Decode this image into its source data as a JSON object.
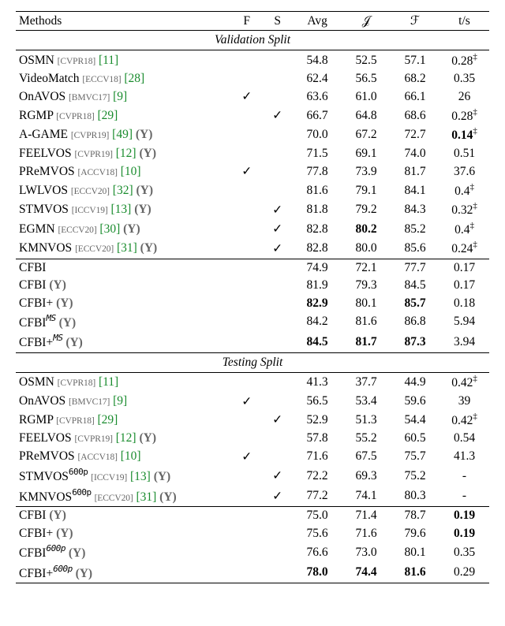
{
  "chart_data": {
    "type": "table",
    "title": "",
    "columns": [
      "Methods",
      "F",
      "S",
      "Avg",
      "J",
      "F",
      "t/s"
    ],
    "sections": [
      {
        "name": "Validation Split",
        "rows": [
          [
            "OSMN [CVPR18] [11]",
            "",
            "",
            54.8,
            52.5,
            57.1,
            "0.28‡"
          ],
          [
            "VideoMatch [ECCV18] [28]",
            "",
            "",
            62.4,
            56.5,
            68.2,
            "0.35"
          ],
          [
            "OnAVOS [BMVC17] [9]",
            "✓",
            "",
            63.6,
            61.0,
            66.1,
            "26"
          ],
          [
            "RGMP [CVPR18] [29]",
            "",
            "✓",
            66.7,
            64.8,
            68.6,
            "0.28‡"
          ],
          [
            "A-GAME [CVPR19] [49] (Y)",
            "",
            "",
            70.0,
            67.2,
            72.7,
            "0.14‡"
          ],
          [
            "FEELVOS [CVPR19] [12] (Y)",
            "",
            "",
            71.5,
            69.1,
            74.0,
            "0.51"
          ],
          [
            "PReMVOS [ACCV18] [10]",
            "✓",
            "",
            77.8,
            73.9,
            81.7,
            "37.6"
          ],
          [
            "LWLVOS [ECCV20] [32] (Y)",
            "",
            "",
            81.6,
            79.1,
            84.1,
            "0.4‡"
          ],
          [
            "STMVOS [ICCV19] [13] (Y)",
            "",
            "✓",
            81.8,
            79.2,
            84.3,
            "0.32‡"
          ],
          [
            "EGMN [ECCV20] [30] (Y)",
            "",
            "✓",
            82.8,
            80.2,
            85.2,
            "0.4‡"
          ],
          [
            "KMNVOS [ECCV20] [31] (Y)",
            "",
            "✓",
            82.8,
            80.0,
            85.6,
            "0.24‡"
          ],
          [
            "CFBI",
            "",
            "",
            74.9,
            72.1,
            77.7,
            "0.17"
          ],
          [
            "CFBI (Y)",
            "",
            "",
            81.9,
            79.3,
            84.5,
            "0.17"
          ],
          [
            "CFBI+ (Y)",
            "",
            "",
            82.9,
            80.1,
            85.7,
            "0.18"
          ],
          [
            "CFBI^MS (Y)",
            "",
            "",
            84.2,
            81.6,
            86.8,
            "5.94"
          ],
          [
            "CFBI+^MS (Y)",
            "",
            "",
            84.5,
            81.7,
            87.3,
            "3.94"
          ]
        ]
      },
      {
        "name": "Testing Split",
        "rows": [
          [
            "OSMN [CVPR18] [11]",
            "",
            "",
            41.3,
            37.7,
            44.9,
            "0.42‡"
          ],
          [
            "OnAVOS [BMVC17] [9]",
            "✓",
            "",
            56.5,
            53.4,
            59.6,
            "39"
          ],
          [
            "RGMP [CVPR18] [29]",
            "",
            "✓",
            52.9,
            51.3,
            54.4,
            "0.42‡"
          ],
          [
            "FEELVOS [CVPR19] [12] (Y)",
            "",
            "",
            57.8,
            55.2,
            60.5,
            "0.54"
          ],
          [
            "PReMVOS [ACCV18] [10]",
            "✓",
            "",
            71.6,
            67.5,
            75.7,
            "41.3"
          ],
          [
            "STMVOS^600p [ICCV19] [13] (Y)",
            "",
            "✓",
            72.2,
            69.3,
            75.2,
            "-"
          ],
          [
            "KMNVOS^600p [ECCV20] [31] (Y)",
            "",
            "✓",
            77.2,
            74.1,
            80.3,
            "-"
          ],
          [
            "CFBI (Y)",
            "",
            "",
            75.0,
            71.4,
            78.7,
            "0.19"
          ],
          [
            "CFBI+ (Y)",
            "",
            "",
            75.6,
            71.6,
            79.6,
            "0.19"
          ],
          [
            "CFBI^600p (Y)",
            "",
            "",
            76.6,
            73.0,
            80.1,
            "0.35"
          ],
          [
            "CFBI+^600p (Y)",
            "",
            "",
            78.0,
            74.4,
            81.6,
            "0.29"
          ]
        ]
      }
    ]
  },
  "head": {
    "methods": "Methods",
    "f": "F",
    "s": "S",
    "avg": "Avg",
    "j": "𝒥",
    "fcal": "ℱ",
    "ts": "t/s"
  },
  "val_title": "Validation Split",
  "test_title": "Testing Split",
  "val": [
    {
      "m": {
        "name": "OSMN",
        "conf": "[CVPR18]",
        "cite": "[11]"
      },
      "f": "",
      "s": "",
      "avg": "54.8",
      "j": "52.5",
      "fc": "57.1",
      "ts": "0.28",
      "dd": true
    },
    {
      "m": {
        "name": "VideoMatch",
        "conf": "[ECCV18]",
        "cite": "[28]"
      },
      "f": "",
      "s": "",
      "avg": "62.4",
      "j": "56.5",
      "fc": "68.2",
      "ts": "0.35"
    },
    {
      "m": {
        "name": "OnAVOS",
        "conf": "[BMVC17]",
        "cite": "[9]"
      },
      "f": "✓",
      "s": "",
      "avg": "63.6",
      "j": "61.0",
      "fc": "66.1",
      "ts": "26"
    },
    {
      "m": {
        "name": "RGMP",
        "conf": "[CVPR18]",
        "cite": "[29]"
      },
      "f": "",
      "s": "✓",
      "avg": "66.7",
      "j": "64.8",
      "fc": "68.6",
      "ts": "0.28",
      "dd": true
    },
    {
      "m": {
        "name": "A-GAME",
        "conf": "[CVPR19]",
        "cite": "[49]",
        "yt": true
      },
      "f": "",
      "s": "",
      "avg": "70.0",
      "j": "67.2",
      "fc": "72.7",
      "ts_b": "0.14",
      "dd": true
    },
    {
      "m": {
        "name": "FEELVOS",
        "conf": "[CVPR19]",
        "cite": "[12]",
        "yt": true
      },
      "f": "",
      "s": "",
      "avg": "71.5",
      "j": "69.1",
      "fc": "74.0",
      "ts": "0.51"
    },
    {
      "m": {
        "name": "PReMVOS",
        "conf": "[ACCV18]",
        "cite": "[10]"
      },
      "f": "✓",
      "s": "",
      "avg": "77.8",
      "j": "73.9",
      "fc": "81.7",
      "ts": "37.6"
    },
    {
      "m": {
        "name": "LWLVOS",
        "conf": "[ECCV20]",
        "cite": "[32]",
        "yt": true
      },
      "f": "",
      "s": "",
      "avg": "81.6",
      "j": "79.1",
      "fc": "84.1",
      "ts": "0.4",
      "dd": true
    },
    {
      "m": {
        "name": "STMVOS",
        "conf": "[ICCV19]",
        "cite": "[13]",
        "yt": true
      },
      "f": "",
      "s": "✓",
      "avg": "81.8",
      "j": "79.2",
      "fc": "84.3",
      "ts": "0.32",
      "dd": true
    },
    {
      "m": {
        "name": "EGMN",
        "conf": "[ECCV20]",
        "cite": "[30]",
        "yt": true
      },
      "f": "",
      "s": "✓",
      "avg": "82.8",
      "j_b": "80.2",
      "fc": "85.2",
      "ts": "0.4",
      "dd": true
    },
    {
      "m": {
        "name": "KMNVOS",
        "conf": "[ECCV20]",
        "cite": "[31]",
        "yt": true
      },
      "f": "",
      "s": "✓",
      "avg": "82.8",
      "j": "80.0",
      "fc": "85.6",
      "ts": "0.24",
      "dd": true
    }
  ],
  "val_cfbi": [
    {
      "m": {
        "plain": "CFBI"
      },
      "avg": "74.9",
      "j": "72.1",
      "fc": "77.7",
      "ts": "0.17"
    },
    {
      "m": {
        "plain": "CFBI",
        "yt": true
      },
      "avg": "81.9",
      "j": "79.3",
      "fc": "84.5",
      "ts": "0.17"
    },
    {
      "m": {
        "plain": "CFBI+",
        "yt": true
      },
      "avg_b": "82.9",
      "j": "80.1",
      "fc_b": "85.7",
      "ts": "0.18"
    },
    {
      "m": {
        "plain": "CFBI",
        "sup": "MS",
        "yt": true
      },
      "avg": "84.2",
      "j": "81.6",
      "fc": "86.8",
      "ts": "5.94"
    },
    {
      "m": {
        "plain": "CFBI+",
        "sup": "MS",
        "yt": true
      },
      "avg_b": "84.5",
      "j_b": "81.7",
      "fc_b": "87.3",
      "ts": "3.94"
    }
  ],
  "test": [
    {
      "m": {
        "name": "OSMN",
        "conf": "[CVPR18]",
        "cite": "[11]"
      },
      "f": "",
      "s": "",
      "avg": "41.3",
      "j": "37.7",
      "fc": "44.9",
      "ts": "0.42",
      "dd": true
    },
    {
      "m": {
        "name": "OnAVOS",
        "conf": "[BMVC17]",
        "cite": "[9]"
      },
      "f": "✓",
      "s": "",
      "avg": "56.5",
      "j": "53.4",
      "fc": "59.6",
      "ts": "39"
    },
    {
      "m": {
        "name": "RGMP",
        "conf": "[CVPR18]",
        "cite": "[29]"
      },
      "f": "",
      "s": "✓",
      "avg": "52.9",
      "j": "51.3",
      "fc": "54.4",
      "ts": "0.42",
      "dd": true
    },
    {
      "m": {
        "name": "FEELVOS",
        "conf": "[CVPR19]",
        "cite": "[12]",
        "yt": true
      },
      "f": "",
      "s": "",
      "avg": "57.8",
      "j": "55.2",
      "fc": "60.5",
      "ts": "0.54"
    },
    {
      "m": {
        "name": "PReMVOS",
        "conf": "[ACCV18]",
        "cite": "[10]"
      },
      "f": "✓",
      "s": "",
      "avg": "71.6",
      "j": "67.5",
      "fc": "75.7",
      "ts": "41.3"
    },
    {
      "m": {
        "name": "STMVOS",
        "sup": "600p",
        "conf": "[ICCV19]",
        "cite": "[13]",
        "yt": true
      },
      "f": "",
      "s": "✓",
      "avg": "72.2",
      "j": "69.3",
      "fc": "75.2",
      "ts": "-"
    },
    {
      "m": {
        "name": "KMNVOS",
        "sup": "600p",
        "conf": "[ECCV20]",
        "cite": "[31]",
        "yt": true
      },
      "f": "",
      "s": "✓",
      "avg": "77.2",
      "j": "74.1",
      "fc": "80.3",
      "ts": "-"
    }
  ],
  "test_cfbi": [
    {
      "m": {
        "plain": "CFBI",
        "yt": true
      },
      "avg": "75.0",
      "j": "71.4",
      "fc": "78.7",
      "ts_b": "0.19"
    },
    {
      "m": {
        "plain": "CFBI+",
        "yt": true
      },
      "avg": "75.6",
      "j": "71.6",
      "fc": "79.6",
      "ts_b": "0.19"
    },
    {
      "m": {
        "plain": "CFBI",
        "sup": "600p",
        "yt": true
      },
      "avg": "76.6",
      "j": "73.0",
      "fc": "80.1",
      "ts": "0.35"
    },
    {
      "m": {
        "plain": "CFBI+",
        "sup": "600p",
        "yt": true
      },
      "avg_b": "78.0",
      "j_b": "74.4",
      "fc_b": "81.6",
      "ts": "0.29"
    }
  ],
  "glyphs": {
    "yt": "(Y)",
    "ddag": "‡"
  }
}
